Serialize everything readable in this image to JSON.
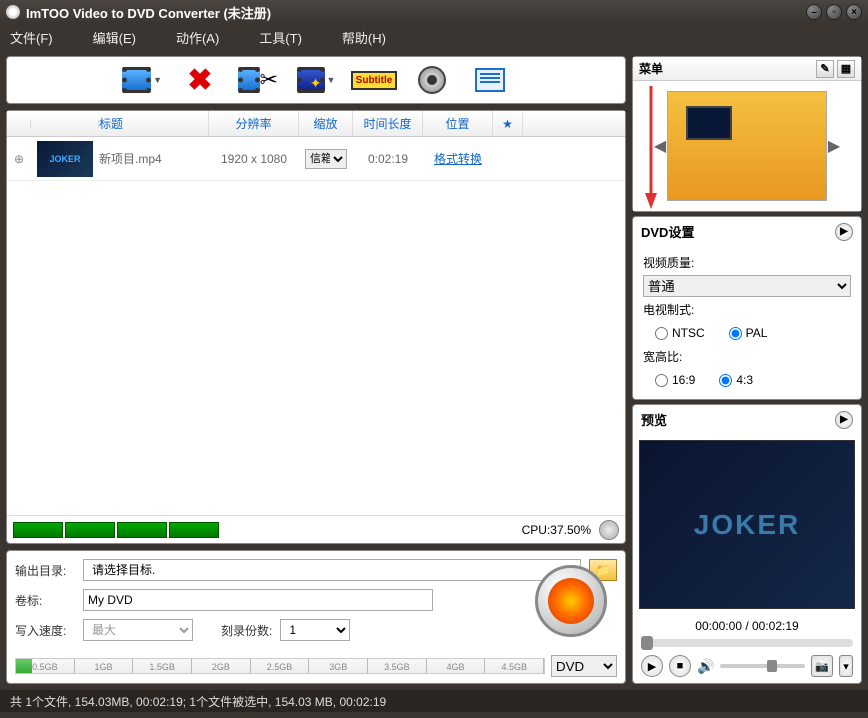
{
  "window": {
    "title": "ImTOO Video to DVD Converter (未注册)"
  },
  "menu": {
    "file": "文件(F)",
    "edit": "编辑(E)",
    "action": "动作(A)",
    "tools": "工具(T)",
    "help": "帮助(H)"
  },
  "toolbar": {
    "add": "add-video",
    "delete": "delete",
    "cut": "cut",
    "effects": "effects",
    "subtitle": "Subtitle",
    "audio": "audio",
    "chapter": "chapter"
  },
  "list": {
    "headers": {
      "title": "标题",
      "resolution": "分辨率",
      "scale": "缩放",
      "duration": "时间长度",
      "position": "位置",
      "star": "★"
    },
    "rows": [
      {
        "thumb": "JOKER",
        "title": "新项目.mp4",
        "resolution": "1920 x 1080",
        "scale": "信箱",
        "duration": "0:02:19",
        "position": "格式转换"
      }
    ]
  },
  "cpu": {
    "label": "CPU:",
    "percent": "37.50%"
  },
  "output": {
    "dir_label": "输出目录:",
    "dir_placeholder": "请选择目标.",
    "volume_label": "卷标:",
    "volume_value": "My DVD",
    "speed_label": "写入速度:",
    "speed_value": "最大",
    "copies_label": "刻录份数:",
    "copies_value": "1"
  },
  "capacity": {
    "ticks": [
      "0.5GB",
      "1GB",
      "1.5GB",
      "2GB",
      "2.5GB",
      "3GB",
      "3.5GB",
      "4GB",
      "4.5GB"
    ],
    "disc": "DVD"
  },
  "right": {
    "menu_head": "菜单",
    "dvd_head": "DVD设置",
    "quality_label": "视频质量:",
    "quality_value": "普通",
    "tv_label": "电视制式:",
    "tv_ntsc": "NTSC",
    "tv_pal": "PAL",
    "aspect_label": "宽高比:",
    "aspect_169": "16:9",
    "aspect_43": "4:3",
    "preview_head": "预览",
    "preview_text": "JOKER",
    "time": "00:00:00 / 00:02:19"
  },
  "status": "共 1个文件, 154.03MB, 00:02:19; 1个文件被选中, 154.03 MB,  00:02:19"
}
